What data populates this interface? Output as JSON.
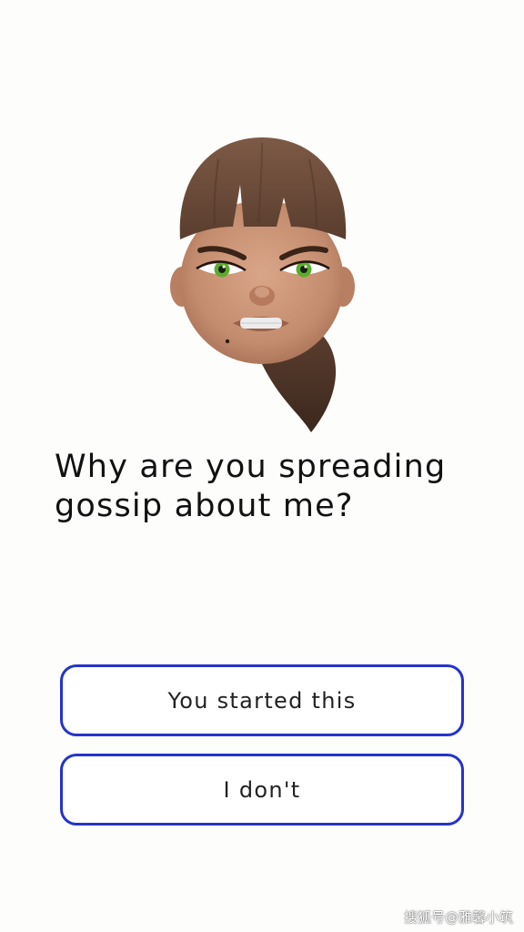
{
  "dialogue": {
    "question": "Why are you spreading gossip about me?",
    "choices": [
      {
        "label": "You started this"
      },
      {
        "label": "I don't"
      }
    ]
  },
  "character": {
    "icon": "angry-memoji-avatar",
    "mood": "angry",
    "skin_color": "#c48c6e",
    "hair_color": "#6b4a38",
    "eye_color": "#5cab2c"
  },
  "watermark": {
    "text": "搜狐号@雅馨小筑"
  },
  "colors": {
    "background": "#fdfdfc",
    "button_border": "#2533c9",
    "text": "#111111"
  }
}
